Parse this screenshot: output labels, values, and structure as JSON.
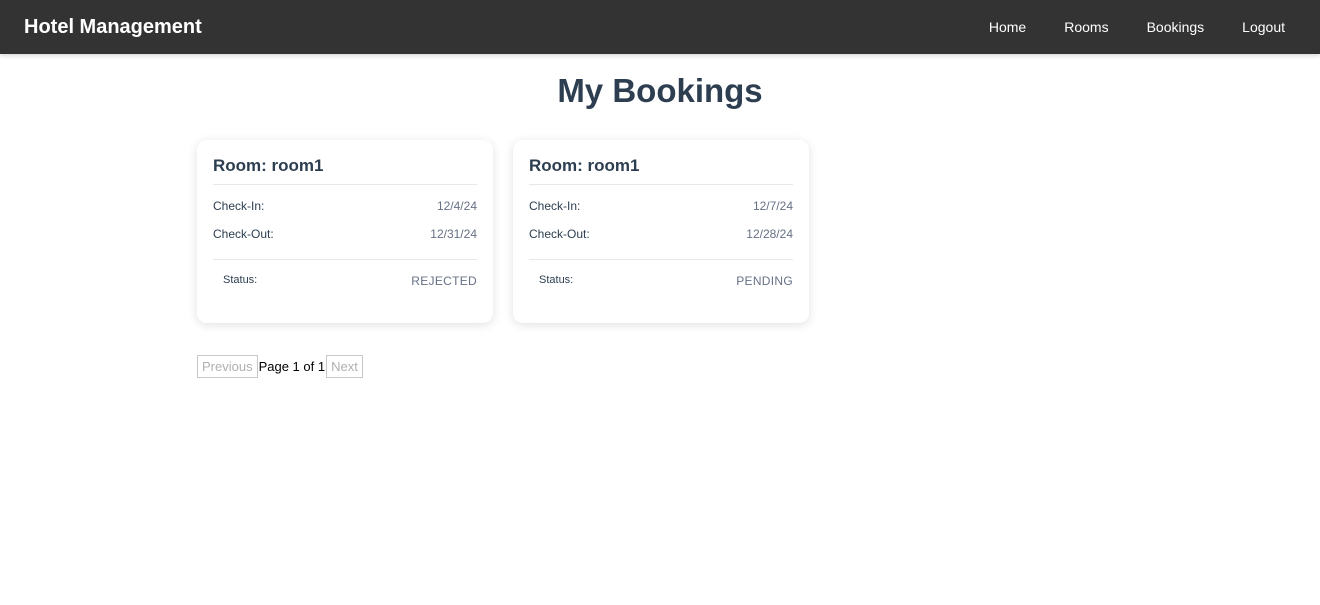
{
  "navbar": {
    "brand": "Hotel Management",
    "links": [
      "Home",
      "Rooms",
      "Bookings",
      "Logout"
    ]
  },
  "page": {
    "title": "My Bookings"
  },
  "labels": {
    "check_in": "Check-In:",
    "check_out": "Check-Out:",
    "status": "Status:"
  },
  "bookings": [
    {
      "room": "Room: room1",
      "check_in": "12/4/24",
      "check_out": "12/31/24",
      "status": "REJECTED"
    },
    {
      "room": "Room: room1",
      "check_in": "12/7/24",
      "check_out": "12/28/24",
      "status": "PENDING"
    }
  ],
  "pagination": {
    "previous": "Previous",
    "info": "Page 1 of 1",
    "next": "Next"
  }
}
